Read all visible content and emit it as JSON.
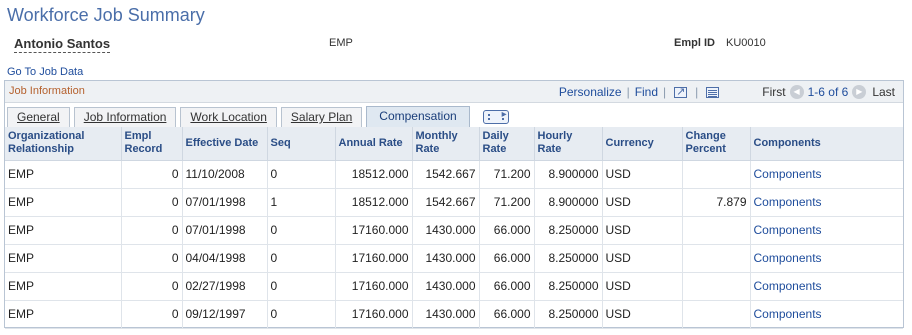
{
  "page": {
    "title": "Workforce Job Summary"
  },
  "employee": {
    "name": "Antonio Santos",
    "type": "EMP",
    "emplid_label": "Empl ID",
    "emplid": "KU0010"
  },
  "links": {
    "go_to_job_data": "Go To Job Data"
  },
  "grid": {
    "title": "Job Information",
    "personalize": "Personalize",
    "find": "Find",
    "nav_first": "First",
    "nav_count": "1-6 of 6",
    "nav_last": "Last",
    "prev_icon": "chevron-left-icon",
    "next_icon": "chevron-right-icon"
  },
  "tabs": [
    {
      "label": "General",
      "active": false
    },
    {
      "label": "Job Information",
      "active": false
    },
    {
      "label": "Work Location",
      "active": false
    },
    {
      "label": "Salary Plan",
      "active": false
    },
    {
      "label": "Compensation",
      "active": true
    }
  ],
  "table": {
    "headers": [
      "Organizational Relationship",
      "Empl Record",
      "Effective Date",
      "Seq",
      "Annual Rate",
      "Monthly Rate",
      "Daily Rate",
      "Hourly Rate",
      "Currency",
      "Change Percent",
      "Components"
    ],
    "rows": [
      [
        "EMP",
        "0",
        "11/10/2008",
        "0",
        "18512.000",
        "1542.667",
        "71.200",
        "8.900000",
        "USD",
        "",
        "Components"
      ],
      [
        "EMP",
        "0",
        "07/01/1998",
        "1",
        "18512.000",
        "1542.667",
        "71.200",
        "8.900000",
        "USD",
        "7.879",
        "Components"
      ],
      [
        "EMP",
        "0",
        "07/01/1998",
        "0",
        "17160.000",
        "1430.000",
        "66.000",
        "8.250000",
        "USD",
        "",
        "Components"
      ],
      [
        "EMP",
        "0",
        "04/04/1998",
        "0",
        "17160.000",
        "1430.000",
        "66.000",
        "8.250000",
        "USD",
        "",
        "Components"
      ],
      [
        "EMP",
        "0",
        "02/27/1998",
        "0",
        "17160.000",
        "1430.000",
        "66.000",
        "8.250000",
        "USD",
        "",
        "Components"
      ],
      [
        "EMP",
        "0",
        "09/12/1997",
        "0",
        "17160.000",
        "1430.000",
        "66.000",
        "8.250000",
        "USD",
        "",
        "Components"
      ]
    ]
  },
  "colors": {
    "title": "#4a6ea9",
    "link": "#1f4d9c",
    "grid_title": "#b5612e",
    "header_bg": "#e7ecf2"
  }
}
